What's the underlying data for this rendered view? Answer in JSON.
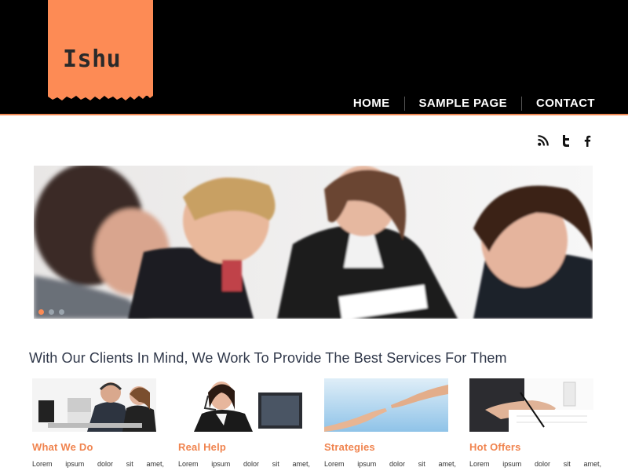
{
  "header": {
    "logo": "Ishu",
    "nav": [
      {
        "label": "HOME"
      },
      {
        "label": "SAMPLE PAGE"
      },
      {
        "label": "CONTACT"
      }
    ]
  },
  "social": [
    {
      "icon": "rss-icon"
    },
    {
      "icon": "twitter-icon"
    },
    {
      "icon": "facebook-icon"
    }
  ],
  "slider": {
    "slide_count": 3,
    "active_index": 0
  },
  "tagline": "With Our Clients In Mind, We Work To Provide The Best Services For Them",
  "features": [
    {
      "title": "What We Do",
      "text": "Lorem ipsum dolor sit amet,"
    },
    {
      "title": "Real Help",
      "text": "Lorem ipsum dolor sit amet,"
    },
    {
      "title": "Strategies",
      "text": "Lorem ipsum dolor sit amet,"
    },
    {
      "title": "Hot Offers",
      "text": "Lorem ipsum dolor sit amet,"
    }
  ],
  "colors": {
    "accent": "#fd8b55",
    "header_bg": "#000000",
    "heading_text": "#30384a"
  }
}
